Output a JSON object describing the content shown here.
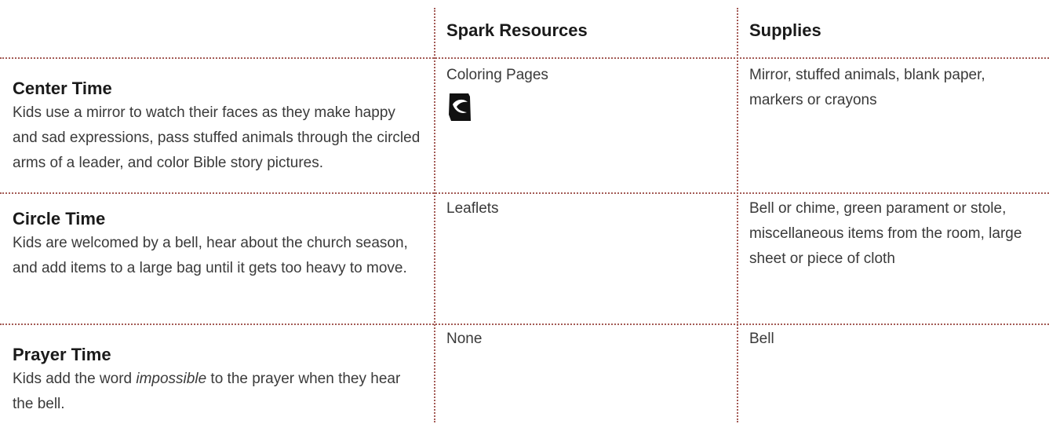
{
  "columns": {
    "resources_header": "Spark Resources",
    "supplies_header": "Supplies"
  },
  "rows": [
    {
      "title": "Center Time",
      "description": "Kids use a mirror to watch their faces as they make happy and sad expressions, pass stuffed animals through the circled arms of a leader, and color Bible story pictures.",
      "resource": "Coloring Pages",
      "resource_icon": "coloring-page-icon",
      "supplies": "Mirror, stuffed animals, blank paper, markers or crayons"
    },
    {
      "title": "Circle Time",
      "description": "Kids are welcomed by a bell, hear about the church season, and add items to a large bag until it gets too heavy to move.",
      "resource": "Leaflets",
      "supplies": "Bell or chime, green parament or stole, miscellaneous items from the room, large sheet or piece of cloth"
    },
    {
      "title": "Prayer Time",
      "description_before": "Kids add the word ",
      "description_em": "impossible",
      "description_after": " to the prayer when they hear the bell.",
      "resource": "None",
      "supplies": "Bell"
    }
  ],
  "colors": {
    "rule": "#a35a55",
    "heading": "#1a1a1a",
    "body": "#3a3a3a"
  }
}
